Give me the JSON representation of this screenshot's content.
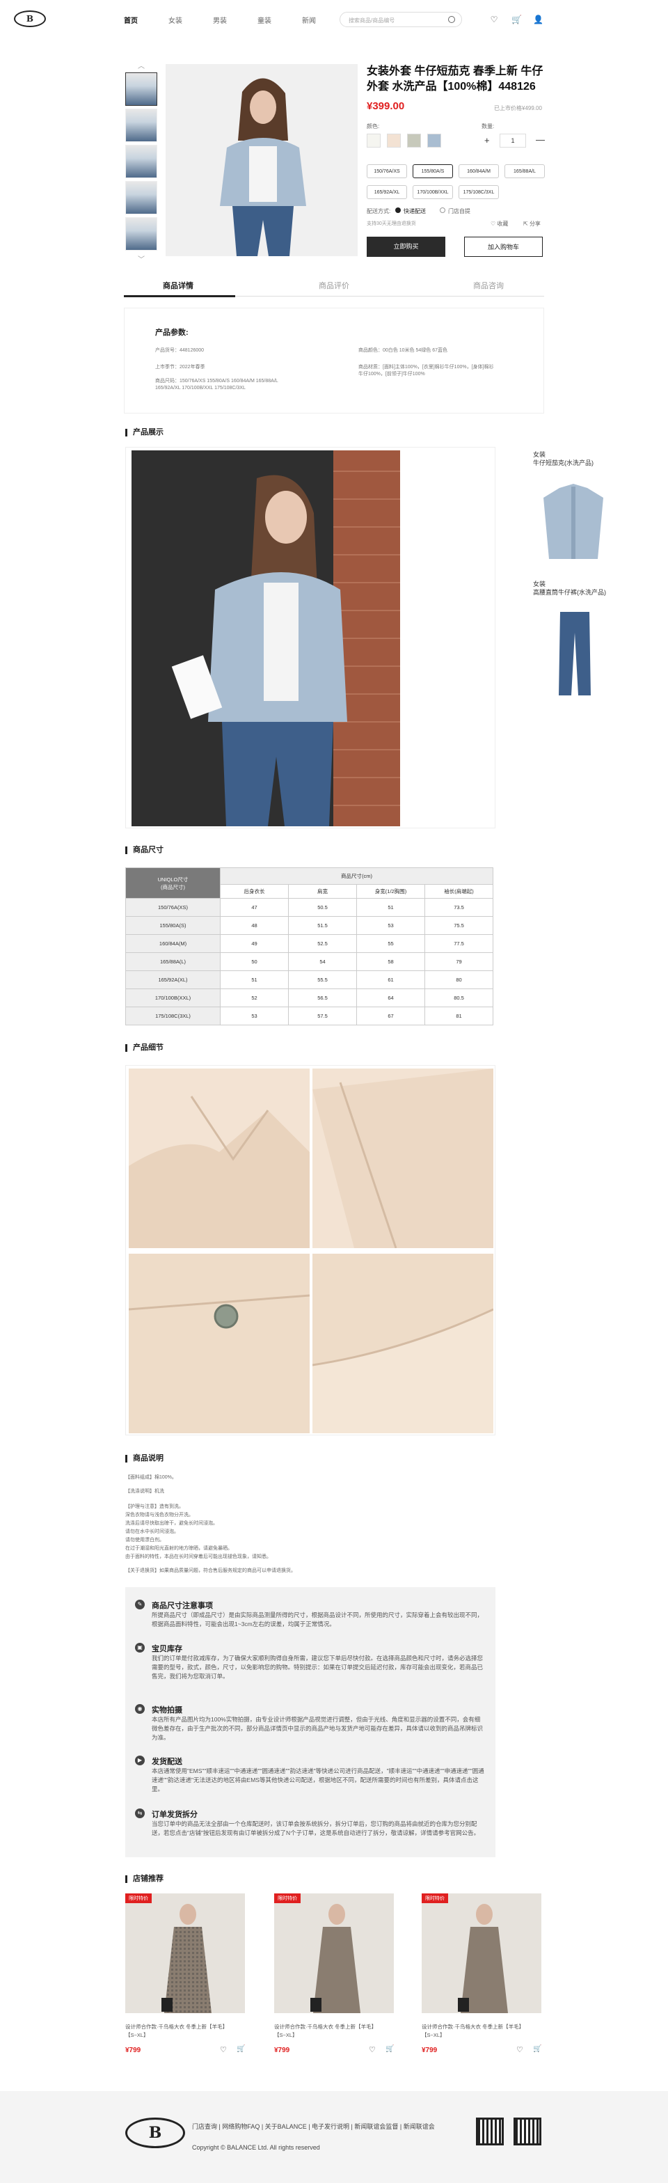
{
  "brand": {
    "logo_text": "B"
  },
  "nav": {
    "items": [
      "首页",
      "女装",
      "男装",
      "童装",
      "新闻"
    ]
  },
  "search": {
    "placeholder": "搜索商品/商品编号"
  },
  "product": {
    "title": "女装外套 牛仔短茄克 春季上新 牛仔外套 水洗产品【100%棉】448126",
    "price": "¥399.00",
    "sold": "已上市价格¥499.00",
    "color_label": "颜色:",
    "qty_label": "数量:",
    "qty": "1",
    "sizes": [
      "150/76A/XS",
      "155/80A/S",
      "160/84A/M",
      "165/88A/L",
      "165/92A/XL",
      "170/100B/XXL",
      "175/108C/3XL"
    ],
    "delivery_label": "配送方式:",
    "delivery_options": [
      "快递配送",
      "门店自提"
    ],
    "return_note": "支持30天无理由退换货",
    "fav": "收藏",
    "share": "分享",
    "buy_now": "立即购买",
    "add_cart": "加入购物车"
  },
  "tabs": [
    "商品详情",
    "商品评价",
    "商品咨询"
  ],
  "params": {
    "title": "产品参数:",
    "left": [
      "产品货号：448126000",
      "上市季节：2022年春季",
      "商品尺码：150/76A/XS 155/80A/S 160/84A/M 165/88A/L 165/92A/XL 170/100B/XXL 175/108C/3XL"
    ],
    "right": [
      "商品颜色：00白色 10米色 54绿色 67蓝色",
      "商品材质：[面料]主体100%，[衣里]棉衫牛仔100%，[身体]棉衫牛仔100%，[前领子]牛仔100%"
    ]
  },
  "sections": {
    "display": "产品展示",
    "size": "商品尺寸",
    "detail": "产品细节",
    "desc": "商品说明",
    "recommend": "店铺推荐"
  },
  "display_products": [
    {
      "cat": "女装",
      "name": "牛仔短茄克(水洗产品)"
    },
    {
      "cat": "女装",
      "name": "高腰直筒牛仔裤(水洗产品)"
    }
  ],
  "size_table": {
    "corner": "UNIQLO尺寸\n(商品尺寸)",
    "group": "商品尺寸(cm)",
    "cols": [
      "后身衣长",
      "肩宽",
      "身宽(1/2胸围)",
      "袖长(肩端起)"
    ],
    "rows": [
      [
        "150/76A(XS)",
        "47",
        "50.5",
        "51",
        "73.5"
      ],
      [
        "155/80A(S)",
        "48",
        "51.5",
        "53",
        "75.5"
      ],
      [
        "160/84A(M)",
        "49",
        "52.5",
        "55",
        "77.5"
      ],
      [
        "165/88A(L)",
        "50",
        "54",
        "58",
        "79"
      ],
      [
        "165/92A(XL)",
        "51",
        "55.5",
        "61",
        "80"
      ],
      [
        "170/100B(XXL)",
        "52",
        "56.5",
        "64",
        "80.5"
      ],
      [
        "175/108C(3XL)",
        "53",
        "57.5",
        "67",
        "81"
      ]
    ]
  },
  "desc": {
    "lines": [
      "【面料组成】棉100%。",
      "【洗涤说明】机洗",
      "【护理与注意】造有到洗。",
      "深色衣物请与浅色衣物分开洗。",
      "洗涤后请尽快取出晾干，避免长时间浸泡。",
      "请勿在水中长时间浸泡。",
      "请勿使用漂白剂。",
      "在过于潮湿和阳光直射的地方晾晒，请避免暴晒。",
      "由于面料的特性，本品在长时间穿着后可能出现褪色现象，请知悉。",
      "【关于退换货】如果商品质量问题，符合售后服务规定的商品可以申请退换货。"
    ]
  },
  "notices": [
    {
      "title": "商品尺寸注意事项",
      "text": "所提商品尺寸（即成品尺寸）是由实际商品测量所得的尺寸，根据商品设计不同，所使用的尺寸，实际穿着上会有较出现不同，根据商品面料特性，可能会出现1~3cm左右的误差，均属于正常情况。"
    },
    {
      "title": "宝贝库存",
      "text": "我们的订单是付款减库存，为了确保大家顺利购得自身所需，建议您下单后尽快付款。在选择商品颜色和尺寸时，请务必选择您需要的型号，款式，颜色，尺寸，以免影响您的购物。特别提示：如果在订单提交后延迟付款，库存可能会出现变化，若商品已售完，我们将为您取消订单。"
    },
    {
      "title": "实物拍摄",
      "text": "本店所有产品图片均为100%实物拍摄，由专业设计师根据产品视觉进行调整，但由于光线、角度和显示器的设置不同，会有细微色差存在，由于生产批次的不同，部分商品详情页中显示的商品产地与发货产地可能存在差异，具体请以收到的商品吊牌标识为准。"
    },
    {
      "title": "发货配送",
      "text": "本店通常使用\"EMS\"\"顺丰速运\"\"中通速递\"\"圆通速递\"\"韵达速递\"等快递公司进行商品配送，\"顺丰速运\"\"中通速递\"\"申通速递\"\"圆通速递\"\"韵达速递\"无法送达的地区将由EMS等其他快递公司配送，根据地区不同，配送所需要的时间也有所差别，具体请点击这里。"
    },
    {
      "title": "订单发货拆分",
      "text": "当您订单中的商品无法全部由一个仓库配送时，该订单会按系统拆分，拆分订单后，您订购的商品将由就近的仓库为您分别配送，若您点击\"店铺\"按钮后发现有由订单被拆分成了N个子订单，这是系统自动进行了拆分，敬请谅解，详情请参考官网公告。"
    }
  ],
  "recommend": [
    {
      "badge": "限时特价",
      "name": "设计师合作款·千鸟格大衣 冬季上新【羊毛】【S~XL】",
      "price": "¥799"
    },
    {
      "badge": "限时特价",
      "name": "设计师合作款·千鸟格大衣 冬季上新【羊毛】【S~XL】",
      "price": "¥799"
    },
    {
      "badge": "限时特价",
      "name": "设计师合作款·千鸟格大衣 冬季上新【羊毛】【S~XL】",
      "price": "¥799"
    }
  ],
  "footer": {
    "links": "门店查询  |  网络购物FAQ  |  关于BALANCE  |  电子发行说明  |  新闻联谊会监督  |  新闻联谊会",
    "copyright": "Copyright © BALANCE Ltd. All rights reserved"
  },
  "colors": {
    "accent": "#e02020",
    "dark": "#2b2b2b"
  }
}
